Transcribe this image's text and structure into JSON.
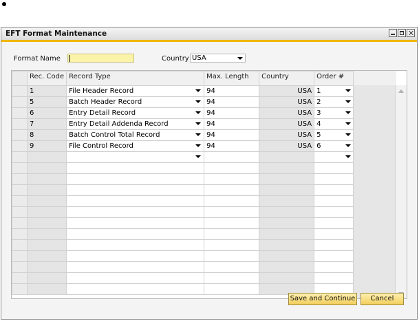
{
  "window": {
    "title": "EFT Format Maintenance"
  },
  "form": {
    "format_name_label": "Format Name",
    "format_name_value": "",
    "country_label": "Country",
    "country_value": "USA"
  },
  "grid": {
    "columns": [
      "Rec. Code",
      "Record Type",
      "Max. Length",
      "Country",
      "Order #"
    ],
    "rows": [
      {
        "rec_code": "1",
        "record_type": "File Header Record",
        "max_length": "94",
        "country": "USA",
        "order": "1"
      },
      {
        "rec_code": "5",
        "record_type": "Batch Header Record",
        "max_length": "94",
        "country": "USA",
        "order": "2"
      },
      {
        "rec_code": "6",
        "record_type": "Entry Detail Record",
        "max_length": "94",
        "country": "USA",
        "order": "3"
      },
      {
        "rec_code": "7",
        "record_type": "Entry Detail Addenda Record",
        "max_length": "94",
        "country": "USA",
        "order": "4"
      },
      {
        "rec_code": "8",
        "record_type": "Batch Control Total Record",
        "max_length": "94",
        "country": "USA",
        "order": "5"
      },
      {
        "rec_code": "9",
        "record_type": "File Control Record",
        "max_length": "94",
        "country": "USA",
        "order": "6"
      }
    ]
  },
  "buttons": {
    "save_continue": "Save and Continue",
    "cancel": "Cancel"
  },
  "colors": {
    "accent": "#f0b800",
    "field_highlight": "#fbf4a8",
    "button": "#f4cf5c"
  },
  "icons": [
    "minimize-icon",
    "maximize-icon",
    "close-icon",
    "dropdown-arrow-icon",
    "scroll-up-icon",
    "scroll-down-icon"
  ]
}
